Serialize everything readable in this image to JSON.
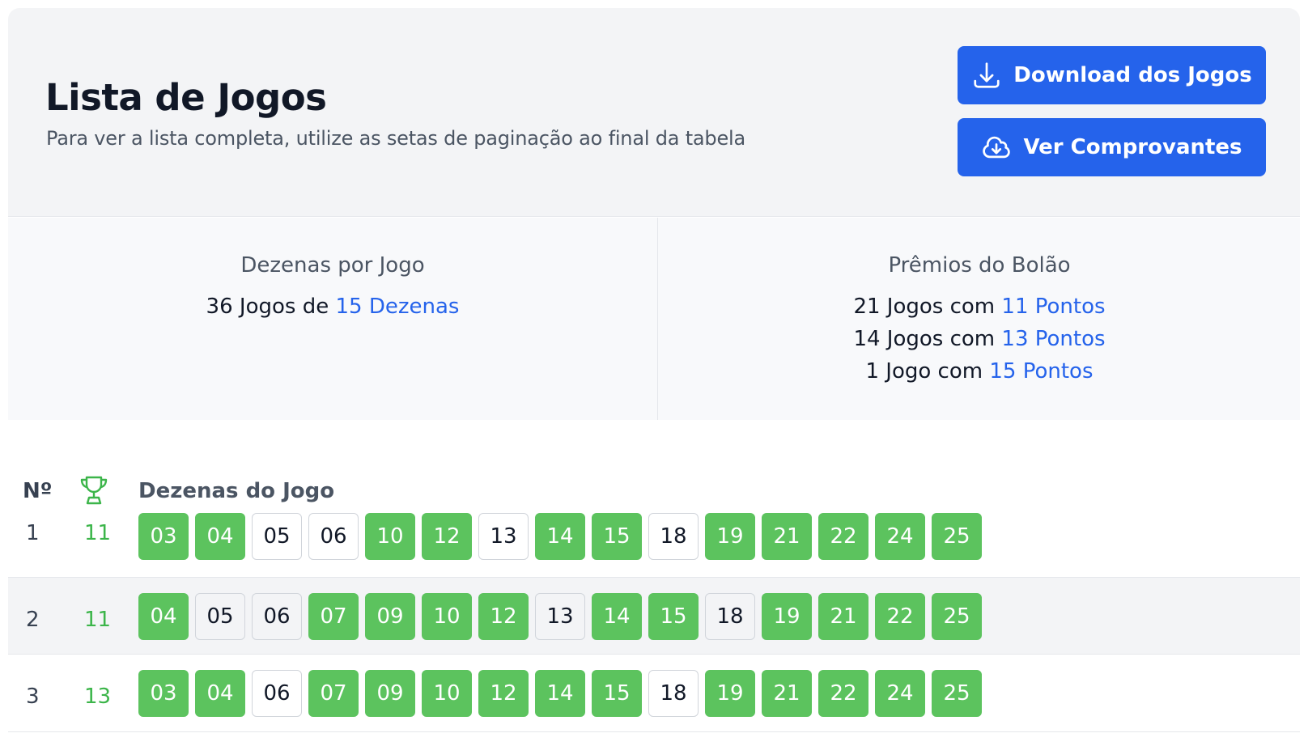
{
  "header": {
    "title": "Lista de Jogos",
    "subtitle": "Para ver a lista completa, utilize as setas de paginação ao final da tabela",
    "download_label": "Download dos Jogos",
    "receipts_label": "Ver Comprovantes"
  },
  "stats": {
    "dezenas_title": "Dezenas por Jogo",
    "dezenas_prefix": "36 Jogos de ",
    "dezenas_highlight": "15 Dezenas",
    "premios_title": "Prêmios do Bolão",
    "premios": [
      {
        "prefix": "21 Jogos com ",
        "highlight": "11 Pontos"
      },
      {
        "prefix": "14 Jogos com ",
        "highlight": "13 Pontos"
      },
      {
        "prefix": "1 Jogo com ",
        "highlight": "15 Pontos"
      }
    ]
  },
  "table": {
    "col_no": "Nº",
    "col_dezenas": "Dezenas do Jogo",
    "rows": [
      {
        "num": "1",
        "points": "11",
        "numbers": [
          {
            "n": "03",
            "hit": true
          },
          {
            "n": "04",
            "hit": true
          },
          {
            "n": "05",
            "hit": false
          },
          {
            "n": "06",
            "hit": false
          },
          {
            "n": "10",
            "hit": true
          },
          {
            "n": "12",
            "hit": true
          },
          {
            "n": "13",
            "hit": false
          },
          {
            "n": "14",
            "hit": true
          },
          {
            "n": "15",
            "hit": true
          },
          {
            "n": "18",
            "hit": false
          },
          {
            "n": "19",
            "hit": true
          },
          {
            "n": "21",
            "hit": true
          },
          {
            "n": "22",
            "hit": true
          },
          {
            "n": "24",
            "hit": true
          },
          {
            "n": "25",
            "hit": true
          }
        ]
      },
      {
        "num": "2",
        "points": "11",
        "numbers": [
          {
            "n": "04",
            "hit": true
          },
          {
            "n": "05",
            "hit": false
          },
          {
            "n": "06",
            "hit": false
          },
          {
            "n": "07",
            "hit": true
          },
          {
            "n": "09",
            "hit": true
          },
          {
            "n": "10",
            "hit": true
          },
          {
            "n": "12",
            "hit": true
          },
          {
            "n": "13",
            "hit": false
          },
          {
            "n": "14",
            "hit": true
          },
          {
            "n": "15",
            "hit": true
          },
          {
            "n": "18",
            "hit": false
          },
          {
            "n": "19",
            "hit": true
          },
          {
            "n": "21",
            "hit": true
          },
          {
            "n": "22",
            "hit": true
          },
          {
            "n": "25",
            "hit": true
          }
        ]
      },
      {
        "num": "3",
        "points": "13",
        "numbers": [
          {
            "n": "03",
            "hit": true
          },
          {
            "n": "04",
            "hit": true
          },
          {
            "n": "06",
            "hit": false
          },
          {
            "n": "07",
            "hit": true
          },
          {
            "n": "09",
            "hit": true
          },
          {
            "n": "10",
            "hit": true
          },
          {
            "n": "12",
            "hit": true
          },
          {
            "n": "14",
            "hit": true
          },
          {
            "n": "15",
            "hit": true
          },
          {
            "n": "18",
            "hit": false
          },
          {
            "n": "19",
            "hit": true
          },
          {
            "n": "21",
            "hit": true
          },
          {
            "n": "22",
            "hit": true
          },
          {
            "n": "24",
            "hit": true
          },
          {
            "n": "25",
            "hit": true
          }
        ]
      }
    ]
  },
  "colors": {
    "accent": "#2563eb",
    "hit": "#5cc35e",
    "points": "#3cb54a"
  },
  "icons": {
    "download": "download-icon",
    "cloud": "cloud-download-icon",
    "trophy": "trophy-icon"
  }
}
